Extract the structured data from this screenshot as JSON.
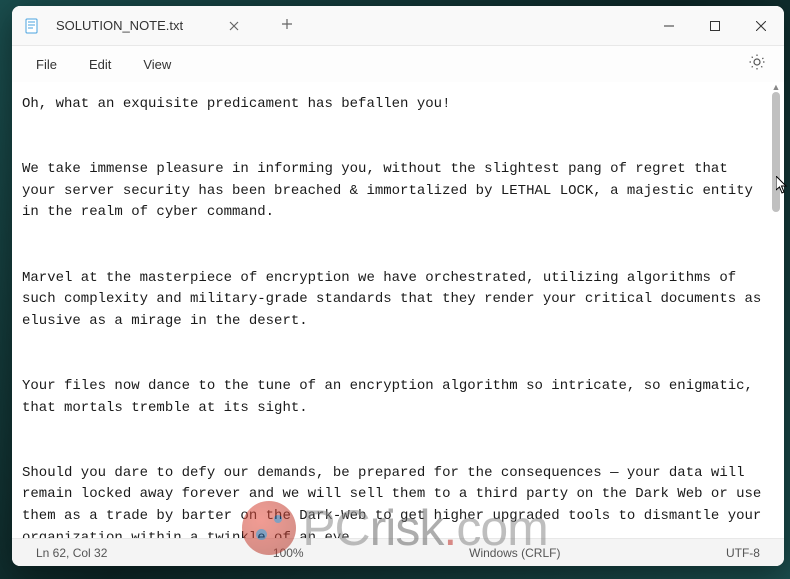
{
  "titlebar": {
    "filename": "SOLUTION_NOTE.txt"
  },
  "menu": {
    "file": "File",
    "edit": "Edit",
    "view": "View"
  },
  "content": {
    "body": "Oh, what an exquisite predicament has befallen you!\n\n\nWe take immense pleasure in informing you, without the slightest pang of regret that your server security has been breached & immortalized by LETHAL LOCK, a majestic entity in the realm of cyber command.\n\n\nMarvel at the masterpiece of encryption we have orchestrated, utilizing algorithms of such complexity and military-grade standards that they render your critical documents as elusive as a mirage in the desert.\n\n\nYour files now dance to the tune of an encryption algorithm so intricate, so enigmatic, that mortals tremble at its sight.\n\n\nShould you dare to defy our demands, be prepared for the consequences — your data will remain locked away forever and we will sell them to a third party on the Dark Web or use them as a trade by barter on the Dark-Web to get higher upgraded tools to dismantle your organization within a twinkle of an eye."
  },
  "statusbar": {
    "position": "Ln 62, Col 32",
    "zoom": "100%",
    "line_ending": "Windows (CRLF)",
    "encoding": "UTF-8"
  },
  "watermark": {
    "pc": "PC",
    "risk": "risk",
    "dot": ".",
    "com": "com"
  }
}
